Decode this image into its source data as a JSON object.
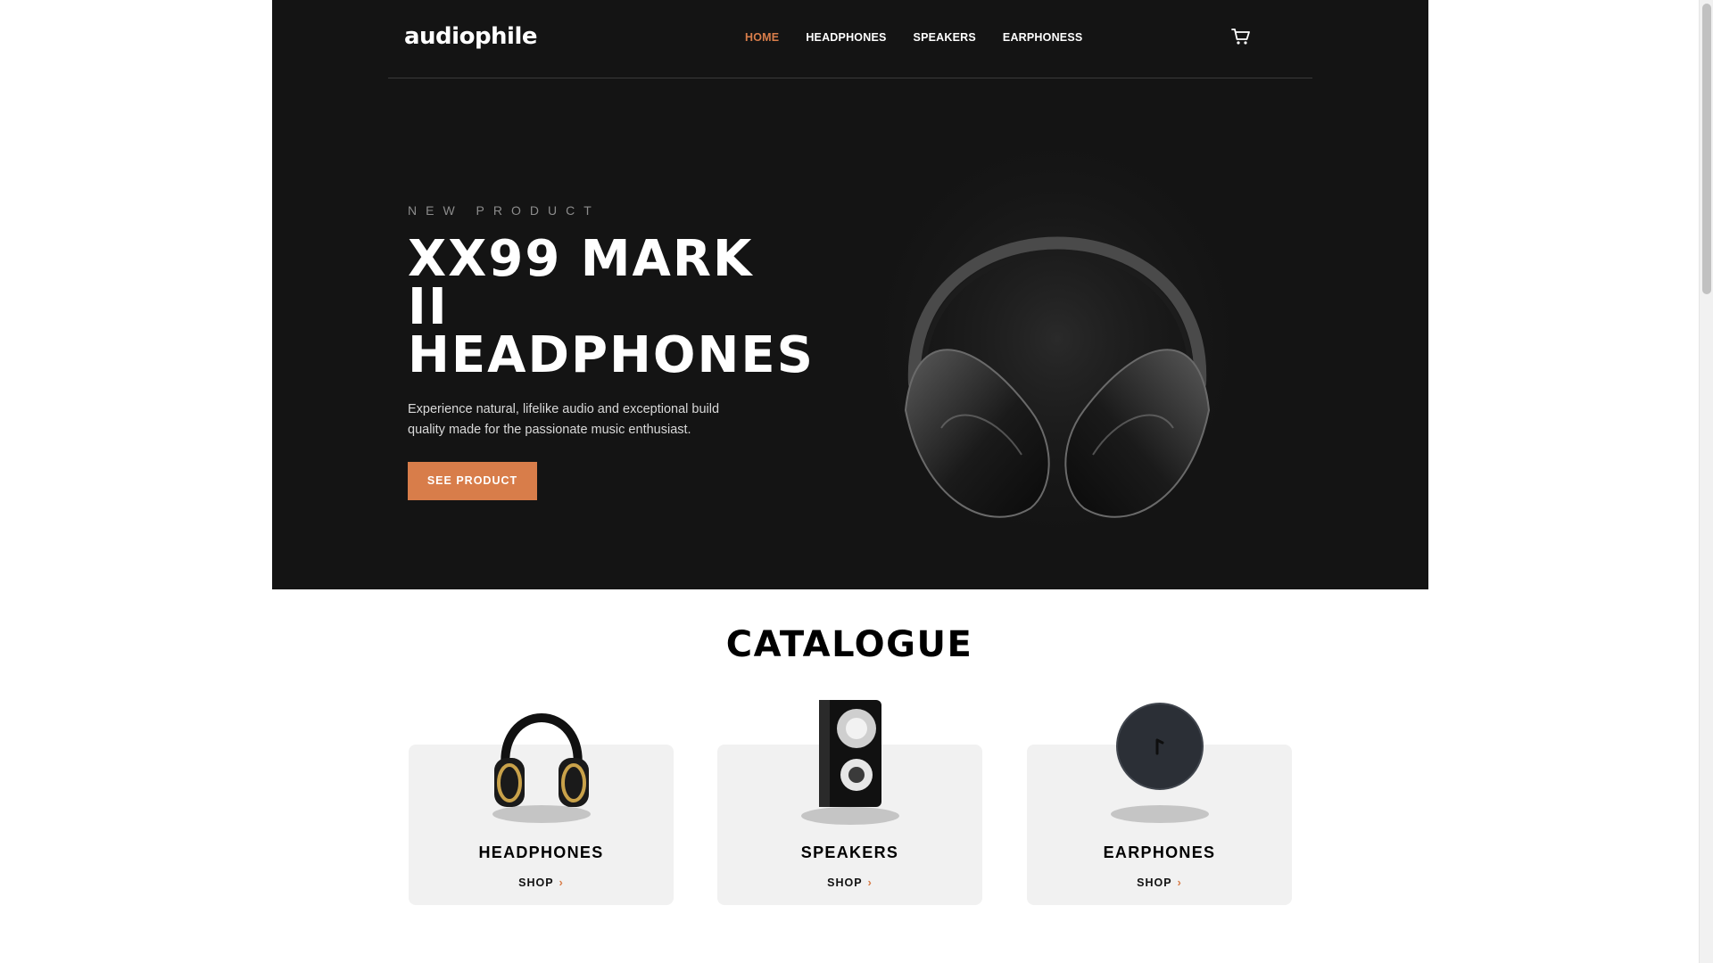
{
  "brand": {
    "logo": "audiophile",
    "accent": "#d87d4a",
    "hero_bg": "#141414"
  },
  "nav": {
    "items": [
      {
        "label": "HOME",
        "active": true
      },
      {
        "label": "HEADPHONES",
        "active": false
      },
      {
        "label": "SPEAKERS",
        "active": false
      },
      {
        "label": "EARPHONESS",
        "active": false
      }
    ],
    "cart_icon": "cart-icon"
  },
  "hero": {
    "eyebrow": "NEW PRODUCT",
    "title": "XX99 MARK II HEADPHONES",
    "description": "Experience natural, lifelike audio and exceptional build quality made for the passionate music enthusiast.",
    "cta": "SEE PRODUCT",
    "image_icon": "headphones-hero-image"
  },
  "catalogue": {
    "title": "CATALOGUE",
    "cards": [
      {
        "title": "HEADPHONES",
        "shop": "SHOP",
        "image_icon": "headphones-image"
      },
      {
        "title": "SPEAKERS",
        "shop": "SHOP",
        "image_icon": "speaker-image"
      },
      {
        "title": "EARPHONES",
        "shop": "SHOP",
        "image_icon": "earphones-image"
      }
    ]
  }
}
